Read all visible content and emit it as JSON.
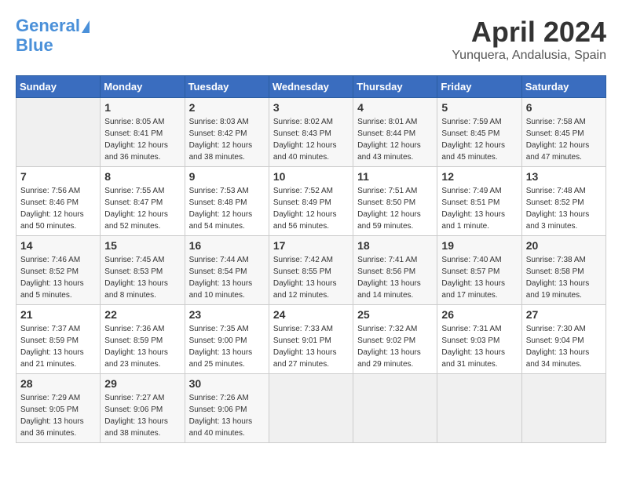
{
  "header": {
    "logo_line1": "General",
    "logo_line2": "Blue",
    "month": "April 2024",
    "location": "Yunquera, Andalusia, Spain"
  },
  "weekdays": [
    "Sunday",
    "Monday",
    "Tuesday",
    "Wednesday",
    "Thursday",
    "Friday",
    "Saturday"
  ],
  "weeks": [
    [
      {
        "day": "",
        "info": ""
      },
      {
        "day": "1",
        "info": "Sunrise: 8:05 AM\nSunset: 8:41 PM\nDaylight: 12 hours\nand 36 minutes."
      },
      {
        "day": "2",
        "info": "Sunrise: 8:03 AM\nSunset: 8:42 PM\nDaylight: 12 hours\nand 38 minutes."
      },
      {
        "day": "3",
        "info": "Sunrise: 8:02 AM\nSunset: 8:43 PM\nDaylight: 12 hours\nand 40 minutes."
      },
      {
        "day": "4",
        "info": "Sunrise: 8:01 AM\nSunset: 8:44 PM\nDaylight: 12 hours\nand 43 minutes."
      },
      {
        "day": "5",
        "info": "Sunrise: 7:59 AM\nSunset: 8:45 PM\nDaylight: 12 hours\nand 45 minutes."
      },
      {
        "day": "6",
        "info": "Sunrise: 7:58 AM\nSunset: 8:45 PM\nDaylight: 12 hours\nand 47 minutes."
      }
    ],
    [
      {
        "day": "7",
        "info": "Sunrise: 7:56 AM\nSunset: 8:46 PM\nDaylight: 12 hours\nand 50 minutes."
      },
      {
        "day": "8",
        "info": "Sunrise: 7:55 AM\nSunset: 8:47 PM\nDaylight: 12 hours\nand 52 minutes."
      },
      {
        "day": "9",
        "info": "Sunrise: 7:53 AM\nSunset: 8:48 PM\nDaylight: 12 hours\nand 54 minutes."
      },
      {
        "day": "10",
        "info": "Sunrise: 7:52 AM\nSunset: 8:49 PM\nDaylight: 12 hours\nand 56 minutes."
      },
      {
        "day": "11",
        "info": "Sunrise: 7:51 AM\nSunset: 8:50 PM\nDaylight: 12 hours\nand 59 minutes."
      },
      {
        "day": "12",
        "info": "Sunrise: 7:49 AM\nSunset: 8:51 PM\nDaylight: 13 hours\nand 1 minute."
      },
      {
        "day": "13",
        "info": "Sunrise: 7:48 AM\nSunset: 8:52 PM\nDaylight: 13 hours\nand 3 minutes."
      }
    ],
    [
      {
        "day": "14",
        "info": "Sunrise: 7:46 AM\nSunset: 8:52 PM\nDaylight: 13 hours\nand 5 minutes."
      },
      {
        "day": "15",
        "info": "Sunrise: 7:45 AM\nSunset: 8:53 PM\nDaylight: 13 hours\nand 8 minutes."
      },
      {
        "day": "16",
        "info": "Sunrise: 7:44 AM\nSunset: 8:54 PM\nDaylight: 13 hours\nand 10 minutes."
      },
      {
        "day": "17",
        "info": "Sunrise: 7:42 AM\nSunset: 8:55 PM\nDaylight: 13 hours\nand 12 minutes."
      },
      {
        "day": "18",
        "info": "Sunrise: 7:41 AM\nSunset: 8:56 PM\nDaylight: 13 hours\nand 14 minutes."
      },
      {
        "day": "19",
        "info": "Sunrise: 7:40 AM\nSunset: 8:57 PM\nDaylight: 13 hours\nand 17 minutes."
      },
      {
        "day": "20",
        "info": "Sunrise: 7:38 AM\nSunset: 8:58 PM\nDaylight: 13 hours\nand 19 minutes."
      }
    ],
    [
      {
        "day": "21",
        "info": "Sunrise: 7:37 AM\nSunset: 8:59 PM\nDaylight: 13 hours\nand 21 minutes."
      },
      {
        "day": "22",
        "info": "Sunrise: 7:36 AM\nSunset: 8:59 PM\nDaylight: 13 hours\nand 23 minutes."
      },
      {
        "day": "23",
        "info": "Sunrise: 7:35 AM\nSunset: 9:00 PM\nDaylight: 13 hours\nand 25 minutes."
      },
      {
        "day": "24",
        "info": "Sunrise: 7:33 AM\nSunset: 9:01 PM\nDaylight: 13 hours\nand 27 minutes."
      },
      {
        "day": "25",
        "info": "Sunrise: 7:32 AM\nSunset: 9:02 PM\nDaylight: 13 hours\nand 29 minutes."
      },
      {
        "day": "26",
        "info": "Sunrise: 7:31 AM\nSunset: 9:03 PM\nDaylight: 13 hours\nand 31 minutes."
      },
      {
        "day": "27",
        "info": "Sunrise: 7:30 AM\nSunset: 9:04 PM\nDaylight: 13 hours\nand 34 minutes."
      }
    ],
    [
      {
        "day": "28",
        "info": "Sunrise: 7:29 AM\nSunset: 9:05 PM\nDaylight: 13 hours\nand 36 minutes."
      },
      {
        "day": "29",
        "info": "Sunrise: 7:27 AM\nSunset: 9:06 PM\nDaylight: 13 hours\nand 38 minutes."
      },
      {
        "day": "30",
        "info": "Sunrise: 7:26 AM\nSunset: 9:06 PM\nDaylight: 13 hours\nand 40 minutes."
      },
      {
        "day": "",
        "info": ""
      },
      {
        "day": "",
        "info": ""
      },
      {
        "day": "",
        "info": ""
      },
      {
        "day": "",
        "info": ""
      }
    ]
  ]
}
